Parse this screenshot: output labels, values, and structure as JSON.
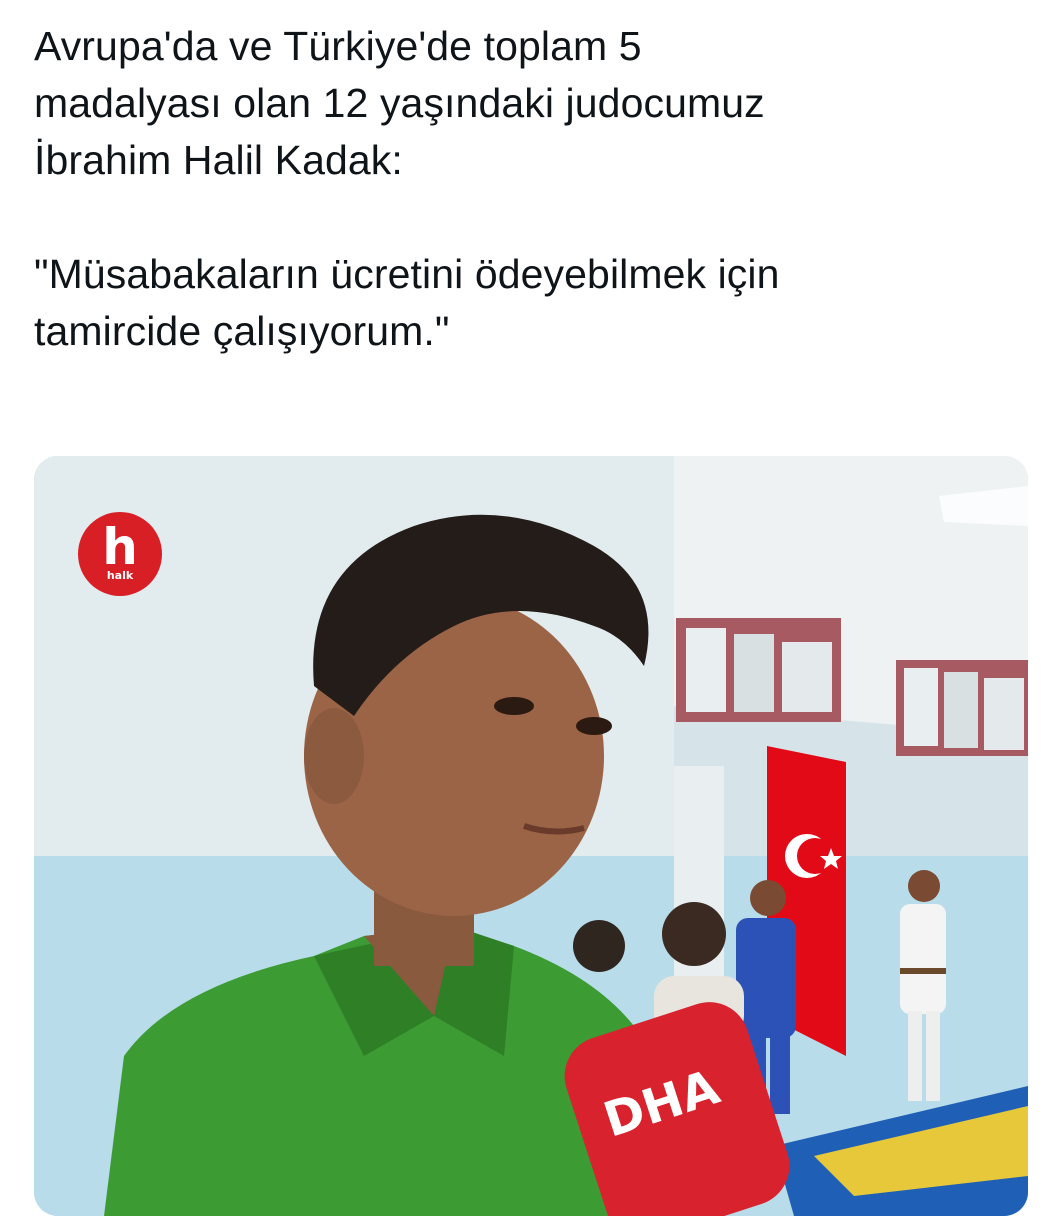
{
  "tweet": {
    "lines": [
      "Avrupa'da ve Türkiye'de toplam 5",
      "madalyası olan 12 yaşındaki judocumuz",
      "İbrahim Halil Kadak:"
    ],
    "quote_lines": [
      "\"Müsabakaların ücretini ödeyebilmek için",
      "tamircide çalışıyorum.\""
    ]
  },
  "media": {
    "channel_logo_mark": "h",
    "channel_logo_word": "halk",
    "microphone_brand": "DHA"
  },
  "colors": {
    "text": "#0f1419",
    "halk_red": "#d81f26",
    "dha_red": "#d8232e",
    "judogi_green": "#3c9b32",
    "turkish_flag_red": "#e30a17"
  }
}
